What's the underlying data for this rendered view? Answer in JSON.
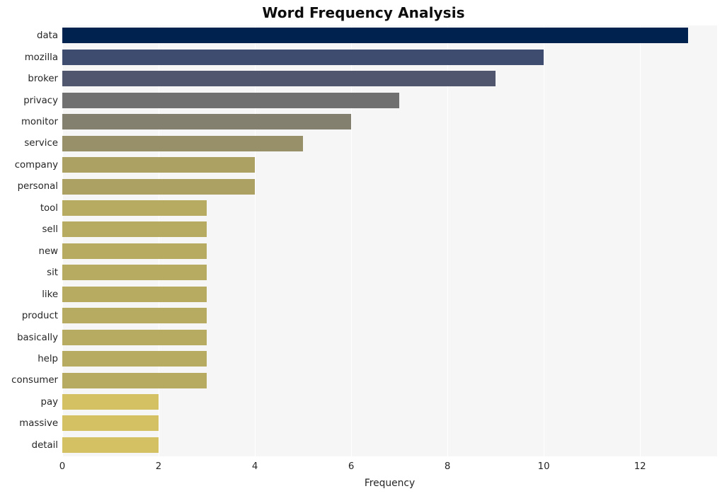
{
  "chart_data": {
    "type": "bar",
    "orientation": "horizontal",
    "title": "Word Frequency Analysis",
    "xlabel": "Frequency",
    "ylabel": "",
    "categories": [
      "data",
      "mozilla",
      "broker",
      "privacy",
      "monitor",
      "service",
      "company",
      "personal",
      "tool",
      "sell",
      "new",
      "sit",
      "like",
      "product",
      "basically",
      "help",
      "consumer",
      "pay",
      "massive",
      "detail"
    ],
    "values": [
      13,
      10,
      9,
      7,
      6,
      5,
      4,
      4,
      3,
      3,
      3,
      3,
      3,
      3,
      3,
      3,
      3,
      2,
      2,
      2
    ],
    "bar_colors": [
      "#00224e",
      "#3e4c70",
      "#4f566e",
      "#717070",
      "#83806f",
      "#979068",
      "#aca162",
      "#aca162",
      "#b6ab61",
      "#b6ab61",
      "#b6ab61",
      "#b6ab61",
      "#b6ab61",
      "#b6ab61",
      "#b6ab61",
      "#b6ab61",
      "#b6ab61",
      "#d3c164",
      "#d3c164",
      "#d3c164"
    ],
    "colormap": "cividis",
    "xlim": [
      0,
      13.6
    ],
    "xticks": [
      0,
      2,
      4,
      6,
      8,
      10,
      12
    ],
    "xticklabels": [
      "0",
      "2",
      "4",
      "6",
      "8",
      "10",
      "12"
    ],
    "grid": true,
    "grid_axis": "x",
    "grid_color": "#ffffff",
    "plot_background": "#f6f6f6",
    "figure_background": "#ffffff",
    "legend": null
  }
}
